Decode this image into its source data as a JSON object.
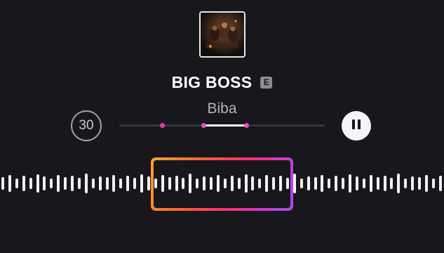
{
  "track": {
    "title": "BIG BOSS",
    "explicit_badge": "E",
    "artist": "Biba",
    "cover_icon": "album-cover-image"
  },
  "controls": {
    "skip_back_label": "30",
    "skip_back_icon": "rewind-30-icon",
    "pause_icon": "pause-icon"
  },
  "scrubber": {
    "selection_start": 0.41,
    "selection_end": 0.62,
    "marker_positions": [
      0.21,
      0.41,
      0.62
    ]
  },
  "colors": {
    "background": "#17171c",
    "accent_marker": "#e83ab0",
    "gradient": [
      "#ffa62b",
      "#ff2d6f",
      "#9f4df2"
    ]
  }
}
